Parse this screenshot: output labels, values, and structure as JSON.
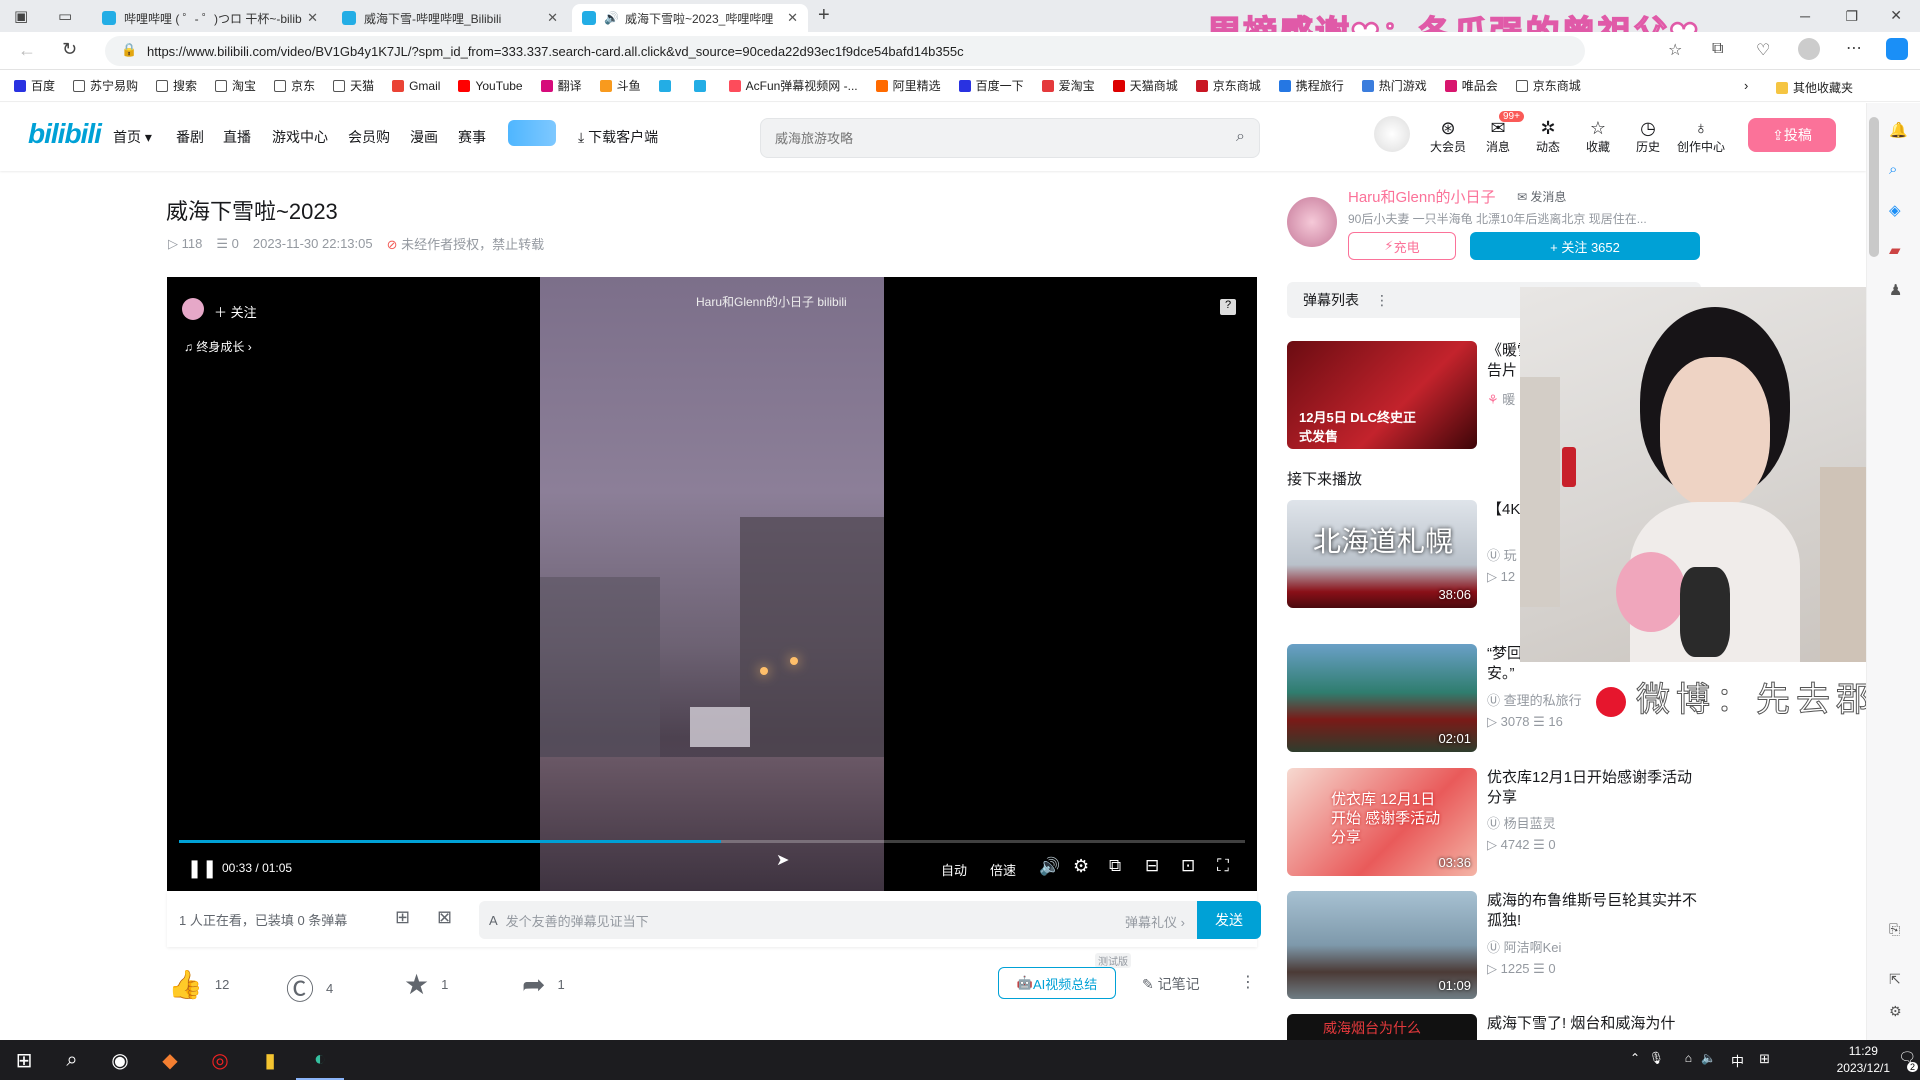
{
  "browser": {
    "tabs": [
      {
        "title": "哔哩哔哩 ( ゜- ゜)つロ 干杯~-bilib"
      },
      {
        "title": "威海下雪-哔哩哔哩_Bilibili"
      },
      {
        "title": "威海下雪啦~2023_哔哩哔哩"
      }
    ],
    "new_tab": "+",
    "url": "https://www.bilibili.com/video/BV1Gb4y1K7JL/?spm_id_from=333.337.search-card.all.click&vd_source=90ceda22d93ec1f9dce54bafd14b355c",
    "bookmarks": [
      "百度",
      "苏宁易购",
      "搜索",
      "淘宝",
      "京东",
      "天猫",
      "Gmail",
      "YouTube",
      "翻译",
      "斗鱼",
      "",
      "",
      "AcFun弹幕视频网 -...",
      "阿里精选",
      "百度一下",
      "爱淘宝",
      "天猫商城",
      "京东商城",
      "携程旅行",
      "热门游戏",
      "唯品会",
      "京东商城"
    ],
    "other_bookmarks": "其他收藏夹"
  },
  "overlay": {
    "title": "周榜感谢❤：冬瓜强的曾祖父❤",
    "weibo": "微博：先去郡"
  },
  "site": {
    "logo": "bilibili",
    "nav": [
      "首页",
      "番剧",
      "直播",
      "游戏中心",
      "会员购",
      "漫画",
      "赛事"
    ],
    "nav_download": "下载客户端",
    "search_placeholder": "威海旅游攻略",
    "header_icons": [
      {
        "label": "大会员",
        "icon": "vip-icon"
      },
      {
        "label": "消息",
        "icon": "message-icon",
        "badge": "99+"
      },
      {
        "label": "动态",
        "icon": "dynamic-icon"
      },
      {
        "label": "收藏",
        "icon": "star-icon"
      },
      {
        "label": "历史",
        "icon": "clock-icon"
      },
      {
        "label": "创作中心",
        "icon": "bulb-icon"
      }
    ],
    "upload": "投稿"
  },
  "video": {
    "title": "威海下雪啦~2023",
    "views": "118",
    "danmaku": "0",
    "datetime": "2023-11-30 22:13:05",
    "copyright": "未经作者授权，禁止转载"
  },
  "player": {
    "follow": "关注",
    "music": "终身成长",
    "watermark": "Haru和Glenn的小日子 bilibili",
    "help": "?",
    "time_current": "00:33",
    "time_sep": "/",
    "time_total": "01:05",
    "progress": 0.508,
    "quality": "自动",
    "speed": "倍速"
  },
  "danmaku_bar": {
    "watching": "1 人正在看，已装填 0 条弹幕",
    "placeholder": "发个友善的弹幕见证当下",
    "etiquette": "弹幕礼仪",
    "send": "发送"
  },
  "actions": {
    "like": "12",
    "coin": "4",
    "fav": "1",
    "share": "1",
    "ai_badge": "测试版",
    "ai_summary": "AI视频总结",
    "notes": "记笔记"
  },
  "uploader": {
    "name": "Haru和Glenn的小日子",
    "message": "发消息",
    "desc": "90后小夫妻 一只半海龟 北漂10年后逃离北京 现居住在...",
    "charge": "充电",
    "follow": "+ 关注 3652"
  },
  "sidebar": {
    "danmaku_list": "弹幕列表",
    "ad": {
      "title1": "《暖雪",
      "title2": "告片",
      "thumb_text": "12月5日 DLC终史正式发售",
      "author": "暖"
    },
    "up_next": "接下来播放",
    "videos": [
      {
        "title": "【4K北海",
        "author": "玩",
        "views": "12",
        "comments": "",
        "duration": "38:06",
        "thumb_text": "北海道札幌"
      },
      {
        "title": "“梦回成了长安。”",
        "author": "查理的私旅行",
        "views": "3078",
        "comments": "16",
        "duration": "02:01",
        "thumb_text": ""
      },
      {
        "title": "优衣库12月1日开始感谢季活动分享",
        "author": "杨目蓝灵",
        "views": "4742",
        "comments": "0",
        "duration": "03:36",
        "thumb_text": "优衣库 12月1日开始 感谢季活动分享"
      },
      {
        "title": "威海的布鲁维斯号巨轮其实并不孤独!",
        "author": "阿洁啊Kei",
        "views": "1225",
        "comments": "0",
        "duration": "01:09",
        "thumb_text": ""
      },
      {
        "title": "威海下雪了! 烟台和威海为什",
        "author": "",
        "views": "",
        "comments": "",
        "duration": "",
        "thumb_text": "威海烟台为什么"
      }
    ]
  },
  "taskbar": {
    "time": "11:29",
    "date": "2023/12/1",
    "ime": "中",
    "notif_count": "2"
  }
}
